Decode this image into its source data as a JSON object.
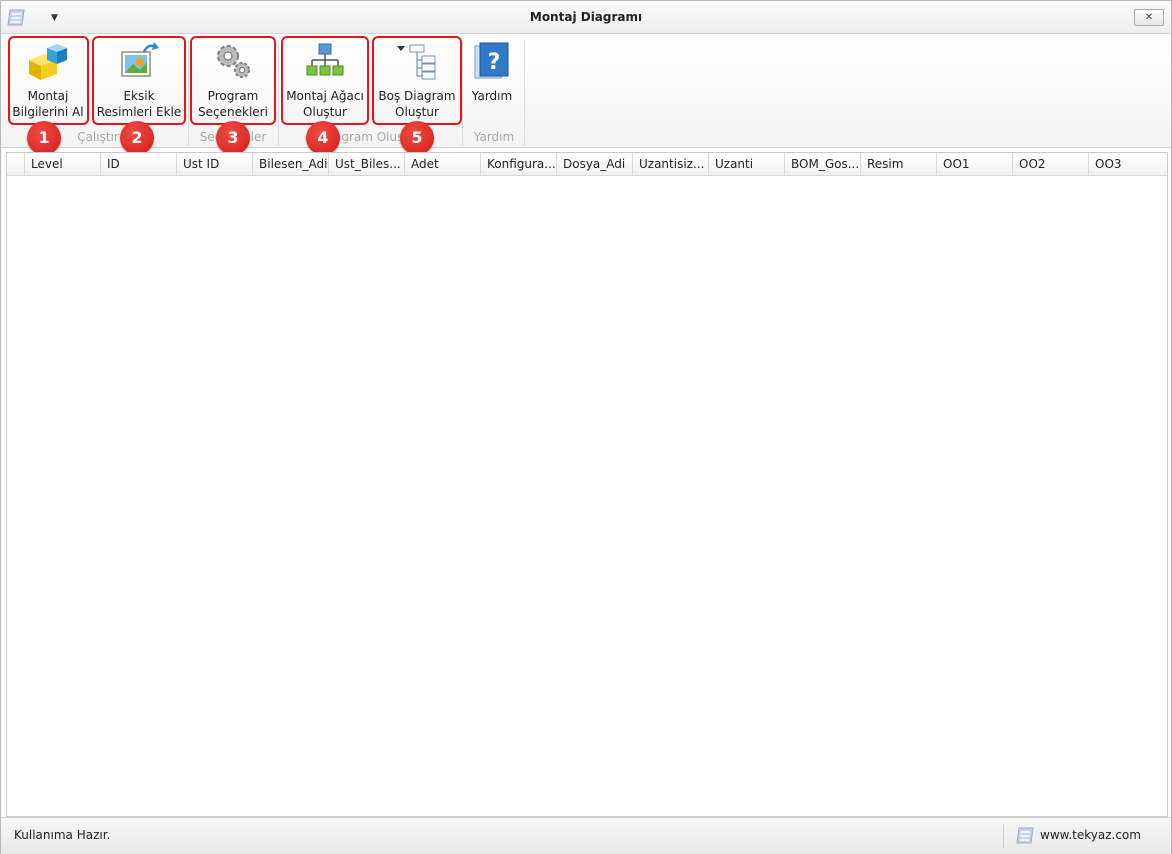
{
  "window": {
    "title": "Montaj Diagramı",
    "close_label": "✕"
  },
  "ribbon": {
    "buttons": [
      {
        "line1": "Montaj",
        "line2": "Bilgilerini Al",
        "badge": "1"
      },
      {
        "line1": "Eksik",
        "line2": "Resimleri Ekle",
        "badge": "2"
      },
      {
        "line1": "Program",
        "line2": "Seçenekleri",
        "badge": "3"
      },
      {
        "line1": "Montaj Ağacı",
        "line2": "Oluştur",
        "badge": "4"
      },
      {
        "line1": "Boş Diagram",
        "line2": "Oluştur",
        "badge": "5"
      },
      {
        "line1": "Yardım",
        "line2": ""
      }
    ],
    "groups": {
      "calistir": "Çalıştır",
      "secenekler": "Seçenekler",
      "diagram": "Diagram Oluştur",
      "yardim": "Yardım"
    },
    "highlight_color": "#e8141b"
  },
  "grid": {
    "columns": [
      "Level",
      "ID",
      "Ust ID",
      "Bilesen_Adi",
      "Ust_Biles...",
      "Adet",
      "Konfigura...",
      "Dosya_Adi",
      "Uzantisiz...",
      "Uzanti",
      "BOM_Gos...",
      "Resim",
      "OO1",
      "OO2",
      "OO3"
    ]
  },
  "status": {
    "text": "Kullanıma Hazır.",
    "site": "www.tekyaz.com"
  }
}
